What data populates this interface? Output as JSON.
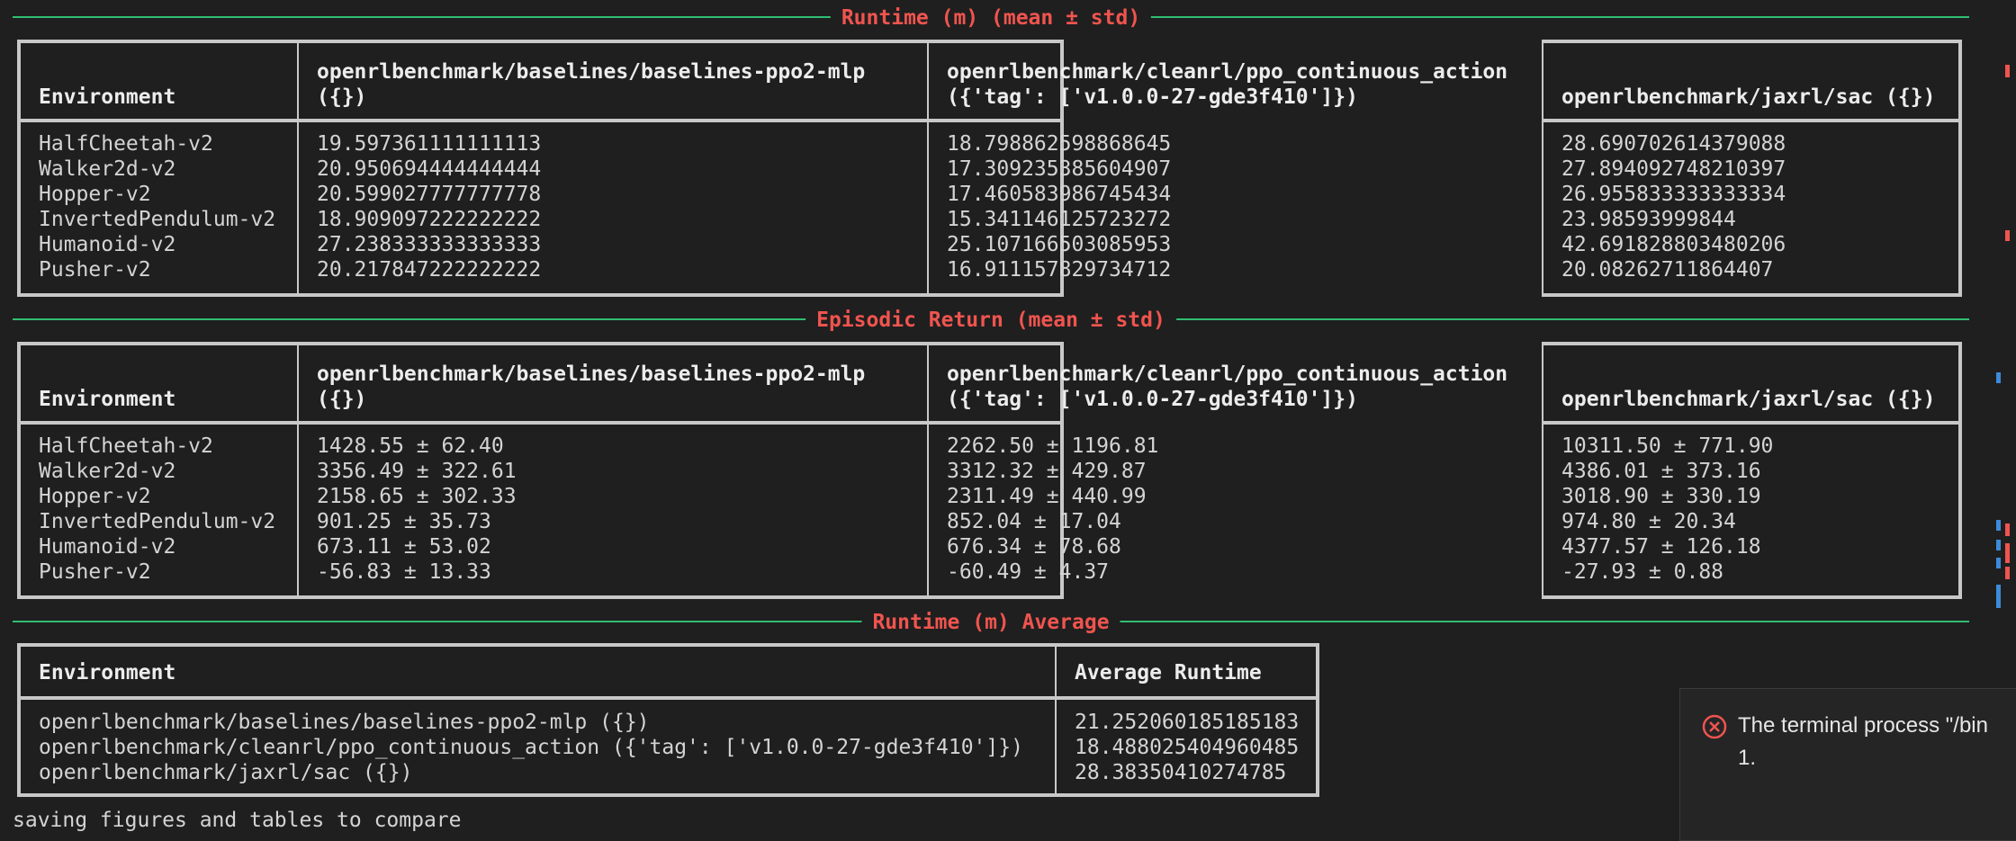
{
  "sections": {
    "runtime_title": "Runtime (m) (mean ± std)",
    "return_title": "Episodic Return (mean ± std)",
    "avg_title": "Runtime (m) Average"
  },
  "runtime_table": {
    "headers": [
      "Environment",
      "openrlbenchmark/baselines/baselines-ppo2-mlp\n({})",
      "openrlbenchmark/cleanrl/ppo_continuous_action\n({'tag': ['v1.0.0-27-gde3f410']})",
      "openrlbenchmark/jaxrl/sac ({})"
    ],
    "columns": [
      "HalfCheetah-v2\nWalker2d-v2\nHopper-v2\nInvertedPendulum-v2\nHumanoid-v2\nPusher-v2",
      "19.597361111111113\n20.950694444444444\n20.599027777777778\n18.909097222222222\n27.238333333333333\n20.217847222222222",
      "18.798862598868645\n17.309235385604907\n17.460583986745434\n15.341146125723272\n25.107166503085953\n16.911157829734712",
      "28.690702614379088\n27.894092748210397\n26.955833333333334\n23.98593999844\n42.691828803480206\n20.08262711864407"
    ]
  },
  "return_table": {
    "headers": [
      "Environment",
      "openrlbenchmark/baselines/baselines-ppo2-mlp\n({})",
      "openrlbenchmark/cleanrl/ppo_continuous_action\n({'tag': ['v1.0.0-27-gde3f410']})",
      "openrlbenchmark/jaxrl/sac ({})"
    ],
    "columns": [
      "HalfCheetah-v2\nWalker2d-v2\nHopper-v2\nInvertedPendulum-v2\nHumanoid-v2\nPusher-v2",
      "1428.55 ± 62.40\n3356.49 ± 322.61\n2158.65 ± 302.33\n901.25 ± 35.73\n673.11 ± 53.02\n-56.83 ± 13.33",
      "2262.50 ± 1196.81\n3312.32 ± 429.87\n2311.49 ± 440.99\n852.04 ± 17.04\n676.34 ± 78.68\n-60.49 ± 4.37",
      "10311.50 ± 771.90\n4386.01 ± 373.16\n3018.90 ± 330.19\n974.80 ± 20.34\n4377.57 ± 126.18\n-27.93 ± 0.88"
    ]
  },
  "avg_table": {
    "headers": [
      "Environment",
      "Average Runtime"
    ],
    "columns": [
      "openrlbenchmark/baselines/baselines-ppo2-mlp ({})\nopenrlbenchmark/cleanrl/ppo_continuous_action ({'tag': ['v1.0.0-27-gde3f410']})\nopenrlbenchmark/jaxrl/sac ({})",
      "21.252060185185183\n18.488025404960485\n28.38350410274785"
    ]
  },
  "footer_text": "saving figures and tables to compare",
  "toast": {
    "message": "The terminal process \"/bin",
    "detail": "1."
  },
  "colors": {
    "accent_title": "#f0544f",
    "rule": "#2fbf71",
    "error_icon": "#f0544f"
  }
}
